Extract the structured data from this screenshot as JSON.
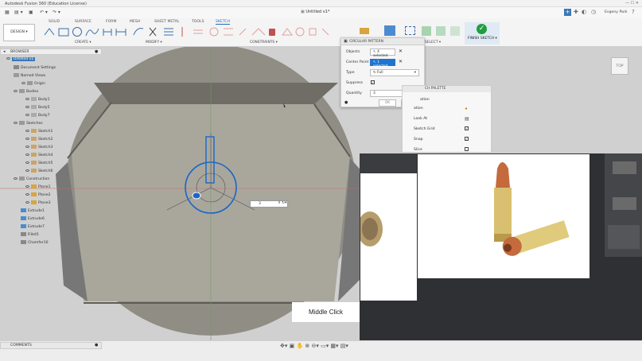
{
  "app": {
    "title": "Autodesk Fusion 360 (Education License)",
    "doc_tab": "Untitled v1*",
    "user": "Evgeny Park"
  },
  "ribbon": {
    "tabs": [
      "SOLID",
      "SURFACE",
      "FORM",
      "MESH",
      "SHEET METAL",
      "TOOLS",
      "SKETCH"
    ],
    "active_tab": "SKETCH",
    "design_label": "DESIGN ▾",
    "groups": {
      "create": "CREATE ▾",
      "modify": "MODIFY ▾",
      "constraints": "CONSTRAINTS ▾",
      "select": "SELECT ▾",
      "finish": "FINISH SKETCH ▾"
    }
  },
  "browser": {
    "header": "BROWSER",
    "items": [
      {
        "label": "Untitled v1"
      },
      {
        "label": "Document Settings"
      },
      {
        "label": "Named Views"
      },
      {
        "label": "Origin"
      },
      {
        "label": "Bodies"
      },
      {
        "label": "Body1"
      },
      {
        "label": "Body5"
      },
      {
        "label": "Body7"
      },
      {
        "label": "Sketches"
      },
      {
        "label": "Sketch1"
      },
      {
        "label": "Sketch2"
      },
      {
        "label": "Sketch3"
      },
      {
        "label": "Sketch4"
      },
      {
        "label": "Sketch5"
      },
      {
        "label": "Sketch6"
      },
      {
        "label": "Construction"
      },
      {
        "label": "Plane1"
      },
      {
        "label": "Plane2"
      },
      {
        "label": "Plane3"
      },
      {
        "label": "Extrude1"
      },
      {
        "label": "Extrude6"
      },
      {
        "label": "Extrude7"
      },
      {
        "label": "Fillet5"
      },
      {
        "label": "Chamfer10"
      }
    ]
  },
  "dialog": {
    "title": "CIRCULAR PATTERN",
    "objects_label": "Objects",
    "objects_value": "4 selected",
    "center_label": "Center Point",
    "center_value": "1 selected",
    "type_label": "Type",
    "type_value": "Full",
    "suppress_label": "Suppress",
    "quantity_label": "Quantity",
    "quantity_value": "3",
    "ok": "OK",
    "cancel": "Cancel"
  },
  "palette": {
    "title": "CH PALETTE",
    "rows": [
      "ation",
      "Look At",
      "Sketch Grid",
      "Snap",
      "Slice"
    ]
  },
  "viewcube": "TOP",
  "quantity_box": "3",
  "comments": "COMMENTS",
  "caption": "Middle Click"
}
